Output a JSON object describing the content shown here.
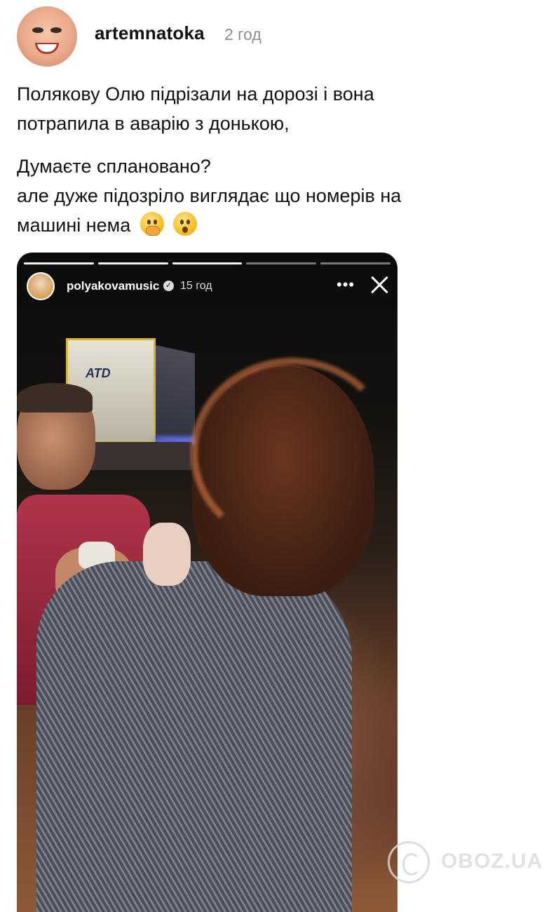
{
  "post": {
    "username": "artemnatoka",
    "time": "2 год",
    "line1": "Полякову Олю підрізали на дорозі і вона",
    "line2": "потрапила в аварію з донькою,",
    "line3": "Думаєте сплановано?",
    "line4": "але дуже підозріло виглядає що номерів на",
    "line5": "машині нема",
    "emoji1": "shushing-face-emoji",
    "emoji2": "surprised-face-emoji"
  },
  "story": {
    "username": "polyakovamusic",
    "time": "15 год",
    "progress_segments": 5,
    "progress_done": 3,
    "truck_logo": "ATD"
  },
  "watermark": {
    "text": "OBOZ.UA"
  },
  "colors": {
    "text": "#111111",
    "muted": "#8e8e8e",
    "story_text": "#ffffff"
  }
}
